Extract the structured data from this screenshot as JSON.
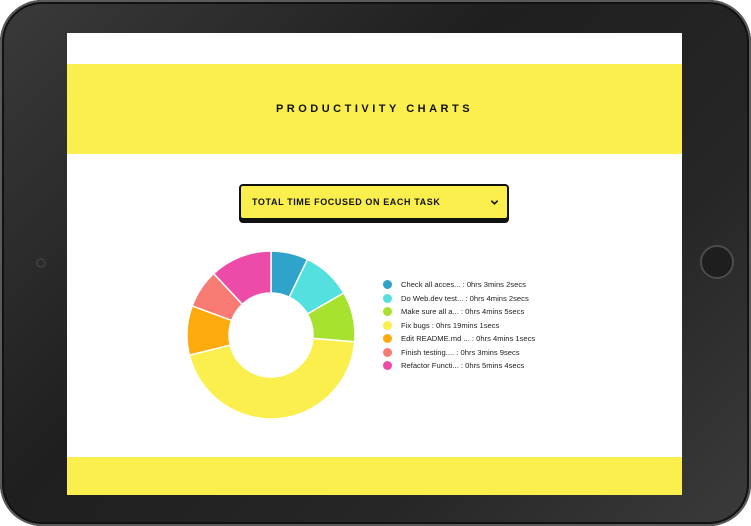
{
  "header": {
    "title": "PRODUCTIVITY CHARTS"
  },
  "chart_selector": {
    "selected": "TOTAL TIME FOCUSED ON EACH TASK"
  },
  "legend": [
    {
      "label": "Check all acces... : 0hrs 3mins 2secs",
      "color": "#2fa3c9"
    },
    {
      "label": "Do Web.dev test... : 0hrs 4mins 2secs",
      "color": "#55e0e0"
    },
    {
      "label": "Make sure all a... : 0hrs 4mins 5secs",
      "color": "#a6e22e"
    },
    {
      "label": "Fix bugs : 0hrs 19mins 1secs",
      "color": "#fbef4d"
    },
    {
      "label": "Edit README.md ... : 0hrs 4mins 1secs",
      "color": "#fdab0c"
    },
    {
      "label": "Finish testing.... : 0hrs 3mins 9secs",
      "color": "#f77b72"
    },
    {
      "label": "Refactor Functi... : 0hrs 5mins 4secs",
      "color": "#ec4ba8"
    }
  ],
  "chart_data": {
    "type": "pie",
    "donut": true,
    "unit": "seconds",
    "categories": [
      "Check all acces...",
      "Do Web.dev test...",
      "Make sure all a...",
      "Fix bugs",
      "Edit README.md ...",
      "Finish testing....",
      "Refactor Functi..."
    ],
    "values": [
      182,
      242,
      245,
      1141,
      241,
      189,
      304
    ],
    "colors": [
      "#2fa3c9",
      "#55e0e0",
      "#a6e22e",
      "#fbef4d",
      "#fdab0c",
      "#f77b72",
      "#ec4ba8"
    ]
  },
  "colors": {
    "accent": "#fbef4d",
    "text": "#111111"
  },
  "icons": {
    "select": "chevron-down-icon"
  }
}
